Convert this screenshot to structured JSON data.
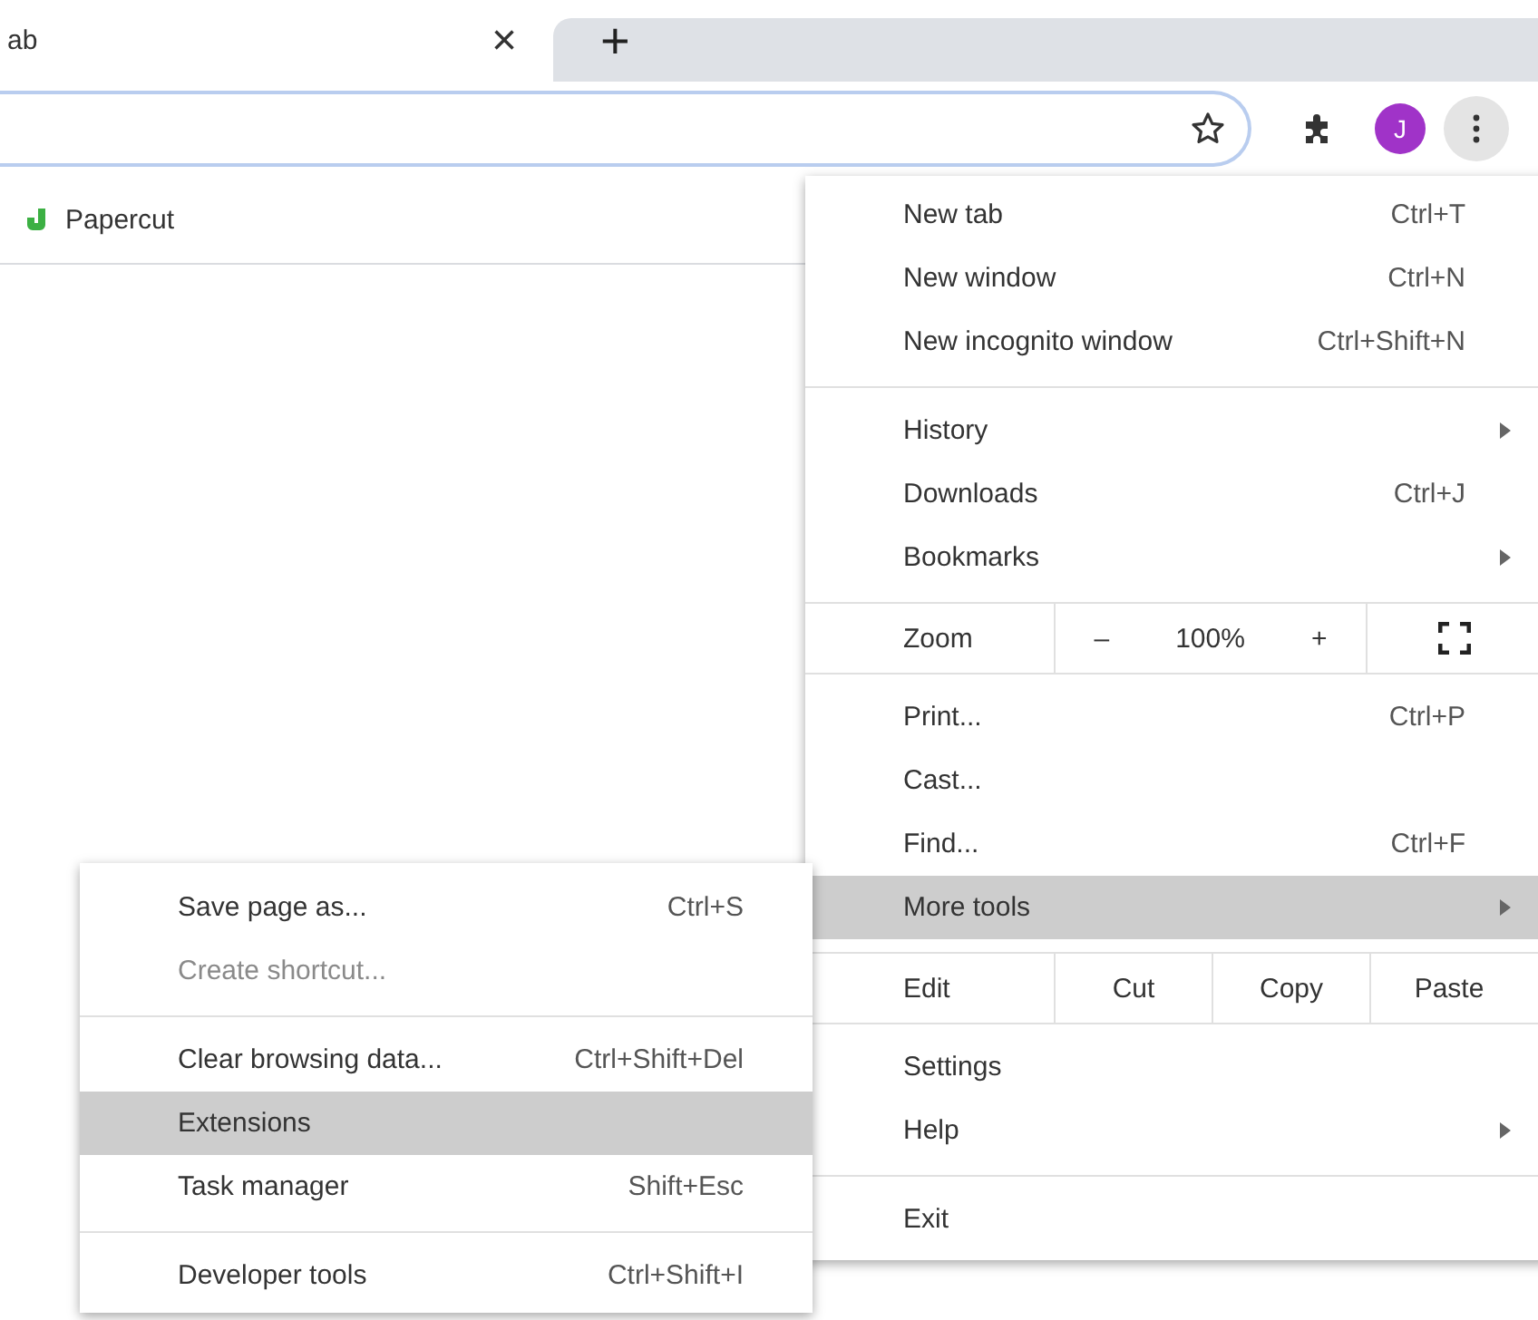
{
  "tab": {
    "title": "ab",
    "close": "×",
    "new_tab": "+"
  },
  "toolbar": {
    "avatar": "J"
  },
  "bookmarks": [
    {
      "label": "Papercut"
    }
  ],
  "menu": [
    {
      "kind": "item",
      "label": "New tab",
      "shortcut": "Ctrl+T",
      "submenu": false,
      "selected": false
    },
    {
      "kind": "item",
      "label": "New window",
      "shortcut": "Ctrl+N",
      "submenu": false,
      "selected": false
    },
    {
      "kind": "item",
      "label": "New incognito window",
      "shortcut": "Ctrl+Shift+N",
      "submenu": false,
      "selected": false
    },
    {
      "kind": "separator"
    },
    {
      "kind": "item",
      "label": "History",
      "submenu": true,
      "selected": false
    },
    {
      "kind": "item",
      "label": "Downloads",
      "shortcut": "Ctrl+J",
      "submenu": false,
      "selected": false
    },
    {
      "kind": "item",
      "label": "Bookmarks",
      "submenu": true,
      "selected": false
    },
    {
      "kind": "zoom",
      "label": "Zoom",
      "minus": "–",
      "value": "100%",
      "plus": "+"
    },
    {
      "kind": "item",
      "label": "Print...",
      "shortcut": "Ctrl+P",
      "submenu": false,
      "selected": false
    },
    {
      "kind": "item",
      "label": "Cast...",
      "submenu": false,
      "selected": false
    },
    {
      "kind": "item",
      "label": "Find...",
      "shortcut": "Ctrl+F",
      "submenu": false,
      "selected": false
    },
    {
      "kind": "item",
      "label": "More tools",
      "submenu": true,
      "selected": true
    },
    {
      "kind": "edit",
      "label": "Edit",
      "buttons": [
        "Cut",
        "Copy",
        "Paste"
      ]
    },
    {
      "kind": "item",
      "label": "Settings",
      "submenu": false,
      "selected": false
    },
    {
      "kind": "item",
      "label": "Help",
      "submenu": true,
      "selected": false
    },
    {
      "kind": "separator"
    },
    {
      "kind": "item",
      "label": "Exit",
      "submenu": false,
      "selected": false
    }
  ],
  "submenu": [
    {
      "kind": "item",
      "label": "Save page as...",
      "shortcut": "Ctrl+S",
      "disabled": false,
      "selected": false
    },
    {
      "kind": "item",
      "label": "Create shortcut...",
      "disabled": true,
      "selected": false
    },
    {
      "kind": "separator"
    },
    {
      "kind": "item",
      "label": "Clear browsing data...",
      "shortcut": "Ctrl+Shift+Del",
      "disabled": false,
      "selected": false
    },
    {
      "kind": "item",
      "label": "Extensions",
      "disabled": false,
      "selected": true
    },
    {
      "kind": "item",
      "label": "Task manager",
      "shortcut": "Shift+Esc",
      "disabled": false,
      "selected": false
    },
    {
      "kind": "separator"
    },
    {
      "kind": "item",
      "label": "Developer tools",
      "shortcut": "Ctrl+Shift+I",
      "disabled": false,
      "selected": false
    }
  ]
}
